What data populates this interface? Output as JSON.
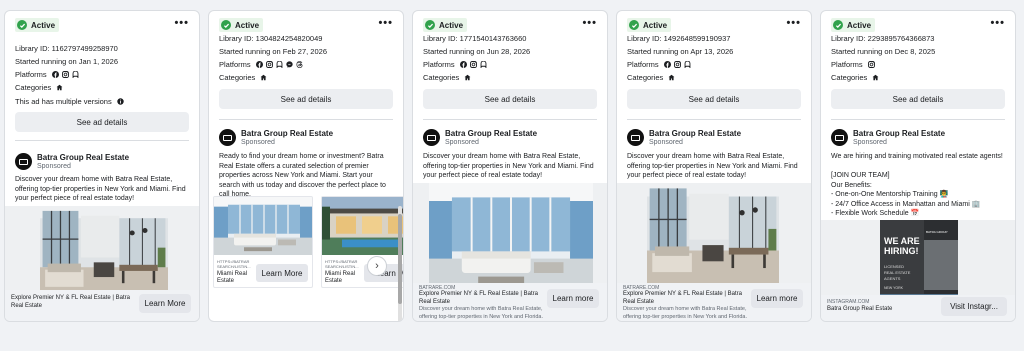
{
  "common": {
    "status": "Active",
    "more": "•••",
    "platforms_label": "Platforms",
    "categories_label": "Categories",
    "see_details": "See ad details",
    "brand": "Batra Group Real Estate",
    "sponsored": "Sponsored"
  },
  "cards": [
    {
      "library_id": "Library ID: 1162797499258970",
      "started": "Started running on Jan 1, 2026",
      "platforms": [
        "facebook-icon",
        "instagram-icon",
        "messenger-icon"
      ],
      "note": "This ad has multiple versions",
      "body": "Discover your dream home with Batra Real Estate, offering top-tier properties in New York and Miami. Find your perfect piece of real estate today!",
      "footer_title": "Explore Premier NY & FL Real Estate | Batra Real Estate",
      "cta": "Learn More"
    },
    {
      "library_id": "Library ID: 1304824254820049",
      "started": "Started running on Feb 27, 2026",
      "platforms": [
        "facebook-icon",
        "instagram-icon",
        "audience-network-icon",
        "messenger-icon",
        "threads-icon"
      ],
      "body": "Ready to find your dream home or investment? Batra Real Estate offers a curated selection of premier properties across New York and Miami. Start your search with us today and discover the perfect place to call home.",
      "carousel": [
        {
          "url": "HTTPS://BATRAR\nSEARCH/LISTIN...",
          "name": "Miami Real\nEstate",
          "cta": "Learn More"
        },
        {
          "url": "HTTPS://BATRAR\nSEARCH/LISTIN...",
          "name": "Miami Real\nEstate",
          "cta": "Learn M"
        }
      ]
    },
    {
      "library_id": "Library ID: 1771540143763660",
      "started": "Started running on Jun 28, 2026",
      "platforms": [
        "facebook-icon",
        "instagram-icon",
        "messenger-icon"
      ],
      "body": "Discover your dream home with Batra Real Estate, offering top-tier properties in New York and Miami. Find your perfect piece of real estate today!",
      "footer_domain": "BATRARE.COM",
      "footer_title": "Explore Premier NY & FL Real Estate | Batra Real Estate",
      "footer_desc": "Discover your dream home with Batra Real Estate, offering top-tier properties in New York and Florida. Fin...",
      "cta": "Learn more"
    },
    {
      "library_id": "Library ID: 1492648599190937",
      "started": "Started running on Apr 13, 2026",
      "platforms": [
        "facebook-icon",
        "instagram-icon",
        "messenger-icon"
      ],
      "body": "Discover your dream home with Batra Real Estate, offering top-tier properties in New York and Miami. Find your perfect piece of real estate today!",
      "footer_domain": "BATRARE.COM",
      "footer_title": "Explore Premier NY & FL Real Estate | Batra Real Estate",
      "footer_desc": "Discover your dream home with Batra Real Estate, offering top-tier properties in New York and Florida. Fin...",
      "cta": "Learn more"
    },
    {
      "library_id": "Library ID: 2293895764366873",
      "started": "Started running on Dec 8, 2025",
      "platforms": [
        "instagram-icon"
      ],
      "body": "We are hiring and training motivated real estate agents!\n\n[JOIN OUR TEAM]\nOur Benefits:\n- One-on-One Mentorship Training 👨‍🏫\n- 24/7 Office Access in Manhattan and Miami 🏢\n- Flexible Work Schedule 📅",
      "hiring": {
        "headline": "WE ARE\nHIRING!",
        "sub": "LICENSED\nREAL ESTATE\nAGENTS",
        "city": "NEW YORK",
        "logo": "BATRA GROUP"
      },
      "footer_domain": "INSTAGRAM.COM",
      "footer_title": "Batra Group Real Estate",
      "cta": "Visit Instagr..."
    }
  ],
  "colors": {
    "active_green": "#31a24c",
    "button_gray": "#e4e6eb",
    "page_bg": "#f0f2f5"
  }
}
